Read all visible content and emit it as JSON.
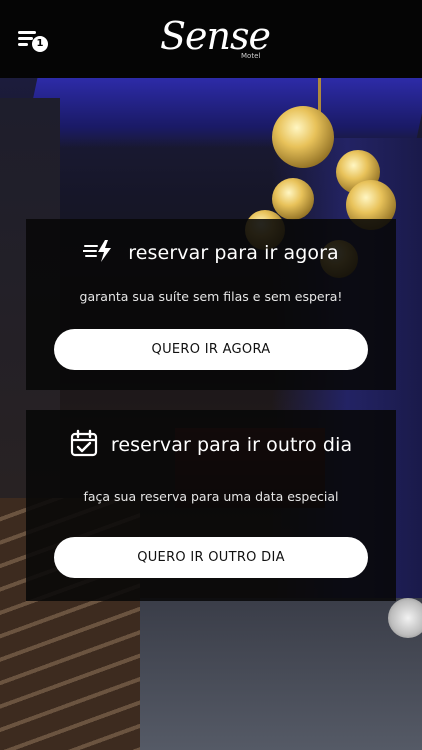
{
  "header": {
    "menu_badge": "1",
    "logo_text": "Sense",
    "logo_subtext": "Motel"
  },
  "cards": {
    "now": {
      "icon": "fast-lightning-icon",
      "title": "reservar para ir agora",
      "description": "garanta sua suíte sem filas e sem espera!",
      "button_label": "QUERO IR AGORA"
    },
    "later": {
      "icon": "calendar-check-icon",
      "title": "reservar para ir outro dia",
      "description": "faça sua reserva para uma data especial",
      "button_label": "QUERO IR OUTRO DIA"
    }
  },
  "colors": {
    "header_bg": "#050505",
    "card_bg": "#080808",
    "button_bg": "#ffffff",
    "text_primary": "#ffffff"
  }
}
